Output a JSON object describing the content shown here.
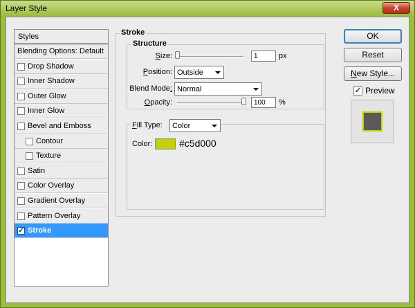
{
  "window": {
    "title": "Layer Style",
    "close_label": "X"
  },
  "styles_list": {
    "header": "Styles",
    "items": [
      {
        "label": "Blending Options: Default",
        "checkbox": false,
        "checked": false,
        "indent": false,
        "selected": false
      },
      {
        "label": "Drop Shadow",
        "checkbox": true,
        "checked": false,
        "indent": false,
        "selected": false
      },
      {
        "label": "Inner Shadow",
        "checkbox": true,
        "checked": false,
        "indent": false,
        "selected": false
      },
      {
        "label": "Outer Glow",
        "checkbox": true,
        "checked": false,
        "indent": false,
        "selected": false
      },
      {
        "label": "Inner Glow",
        "checkbox": true,
        "checked": false,
        "indent": false,
        "selected": false
      },
      {
        "label": "Bevel and Emboss",
        "checkbox": true,
        "checked": false,
        "indent": false,
        "selected": false
      },
      {
        "label": "Contour",
        "checkbox": true,
        "checked": false,
        "indent": true,
        "selected": false
      },
      {
        "label": "Texture",
        "checkbox": true,
        "checked": false,
        "indent": true,
        "selected": false
      },
      {
        "label": "Satin",
        "checkbox": true,
        "checked": false,
        "indent": false,
        "selected": false
      },
      {
        "label": "Color Overlay",
        "checkbox": true,
        "checked": false,
        "indent": false,
        "selected": false
      },
      {
        "label": "Gradient Overlay",
        "checkbox": true,
        "checked": false,
        "indent": false,
        "selected": false
      },
      {
        "label": "Pattern Overlay",
        "checkbox": true,
        "checked": false,
        "indent": false,
        "selected": false
      },
      {
        "label": "Stroke",
        "checkbox": true,
        "checked": true,
        "indent": false,
        "selected": true
      }
    ]
  },
  "stroke": {
    "group_title": "Stroke",
    "structure_title": "Structure",
    "size": {
      "label_u": "S",
      "label_rest": "ize:",
      "value": "1",
      "unit": "px",
      "slider_fraction": 0.0
    },
    "position": {
      "label_u": "P",
      "label_rest": "osition:",
      "value": "Outside"
    },
    "blend_mode": {
      "label_pre": "Blend Mode",
      "label_post": ":",
      "value": "Normal"
    },
    "opacity": {
      "label_u": "O",
      "label_rest": "pacity:",
      "value": "100",
      "unit": "%",
      "slider_fraction": 1.0
    },
    "fill_type": {
      "label_u": "F",
      "label_rest": "ill Type:",
      "value": "Color"
    },
    "color": {
      "label": "Color:",
      "value": "#c5d000",
      "hex_label": "#c5d000"
    }
  },
  "buttons": {
    "ok": "OK",
    "reset": "Reset",
    "new_style_u": "N",
    "new_style_rest": "ew Style...",
    "preview_label": "Preview",
    "preview_checked": true
  },
  "colors": {
    "selection": "#3399ff",
    "stroke_color": "#c5d000",
    "title_bar": "#9bbe3a"
  }
}
